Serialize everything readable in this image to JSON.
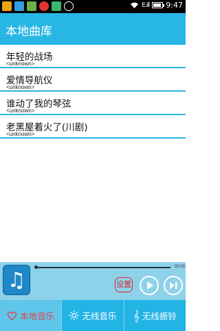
{
  "status_bar": {
    "time": "9:47",
    "signal_text": "E.ill",
    "battery_level": 0.95,
    "icons": [
      "notification-icon",
      "music-icon",
      "image-icon",
      "browser-icon",
      "game-icon",
      "upload-icon",
      "wifi-icon"
    ]
  },
  "header": {
    "title": "本地曲库"
  },
  "songs": [
    {
      "title": "年轻的战场",
      "artist": "<unknown>"
    },
    {
      "title": "爱情导航仪",
      "artist": "<unknown>"
    },
    {
      "title": "谁动了我的琴弦",
      "artist": "<unknown>"
    },
    {
      "title": "老黑屋着火了(川剧)",
      "artist": "<unknown>"
    }
  ],
  "player": {
    "progress_fraction": 0.0,
    "time_label": "00:00",
    "settings_label": "设置",
    "album_icon": "music-note-icon"
  },
  "tabs": [
    {
      "label": "本地音乐",
      "icon": "heart-icon",
      "active": true
    },
    {
      "label": "无线音乐",
      "icon": "sun-icon",
      "active": false
    },
    {
      "label": "无线振铃",
      "icon": "treble-clef-icon",
      "active": false
    }
  ],
  "colors": {
    "accent": "#28b6e4",
    "player_bg": "#8ed2ea",
    "active_tab_text": "#e2474a",
    "settings_red": "#d9242a"
  }
}
